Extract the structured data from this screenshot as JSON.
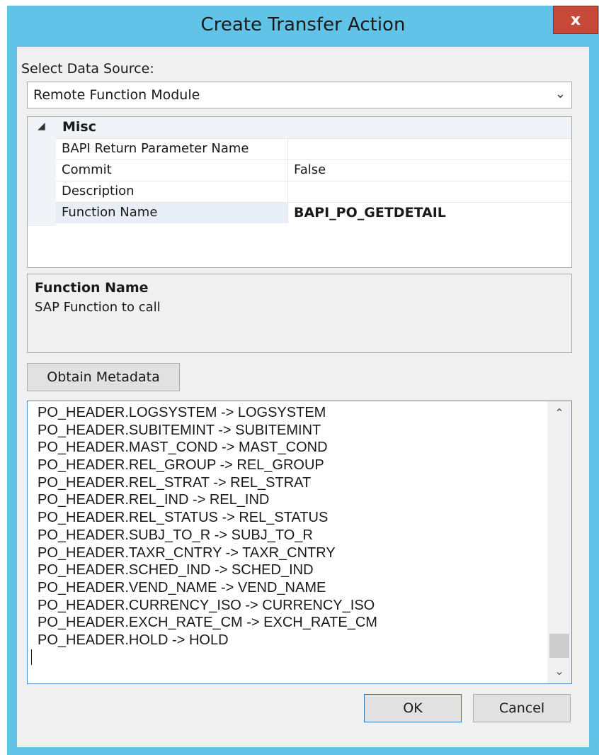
{
  "window": {
    "title": "Create Transfer Action",
    "close_label": "x"
  },
  "data_source": {
    "label": "Select Data Source:",
    "selected": "Remote Function Module"
  },
  "property_grid": {
    "category": "Misc",
    "rows": [
      {
        "name": "BAPI Return Parameter Name",
        "value": ""
      },
      {
        "name": "Commit",
        "value": "False"
      },
      {
        "name": "Description",
        "value": ""
      },
      {
        "name": "Function Name",
        "value": "BAPI_PO_GETDETAIL"
      }
    ]
  },
  "help_panel": {
    "title": "Function Name",
    "description": "SAP Function to call"
  },
  "buttons": {
    "obtain_metadata": "Obtain Metadata",
    "ok": "OK",
    "cancel": "Cancel"
  },
  "mappings": [
    "PO_HEADER.LOGSYSTEM -> LOGSYSTEM",
    "PO_HEADER.SUBITEMINT -> SUBITEMINT",
    "PO_HEADER.MAST_COND -> MAST_COND",
    "PO_HEADER.REL_GROUP -> REL_GROUP",
    "PO_HEADER.REL_STRAT -> REL_STRAT",
    "PO_HEADER.REL_IND -> REL_IND",
    "PO_HEADER.REL_STATUS -> REL_STATUS",
    "PO_HEADER.SUBJ_TO_R -> SUBJ_TO_R",
    "PO_HEADER.TAXR_CNTRY -> TAXR_CNTRY",
    "PO_HEADER.SCHED_IND -> SCHED_IND",
    "PO_HEADER.VEND_NAME -> VEND_NAME",
    "PO_HEADER.CURRENCY_ISO -> CURRENCY_ISO",
    "PO_HEADER.EXCH_RATE_CM -> EXCH_RATE_CM",
    "PO_HEADER.HOLD -> HOLD"
  ]
}
